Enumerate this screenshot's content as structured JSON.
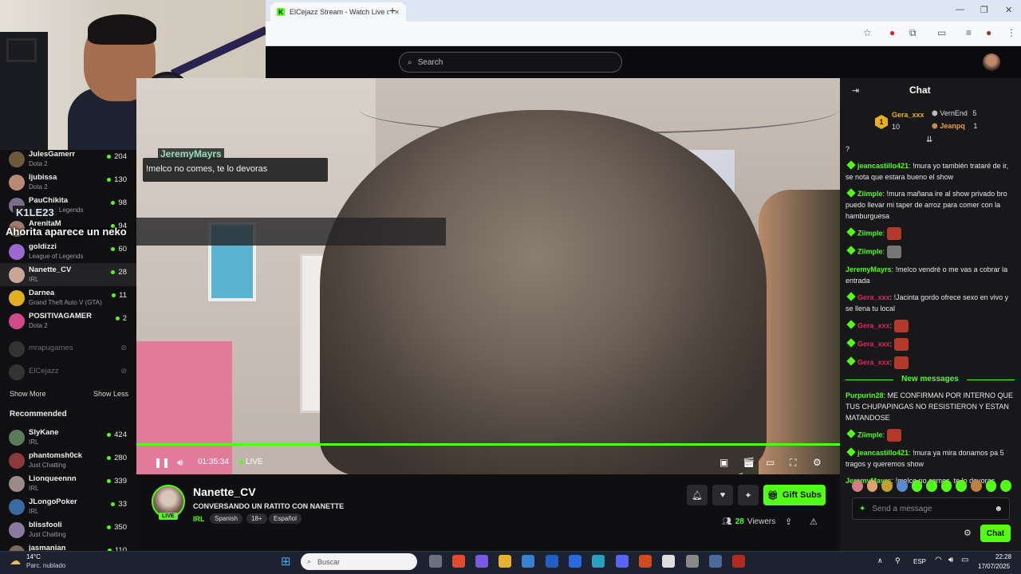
{
  "browser": {
    "tab_title": "ElCejazz Stream - Watch Live o",
    "favicon": "K",
    "new_tab": "+",
    "minimize": "—",
    "maximize": "❐",
    "close": "✕"
  },
  "webcam_overlay": {
    "tag_user": "K1LE23",
    "caption": "Ahorita aparece un neko"
  },
  "header": {
    "search_placeholder": "Search"
  },
  "sidebar": {
    "followed": [
      {
        "name": "JulesGamerr",
        "category": "Dota 2",
        "viewers": "204",
        "color": "#6d5a3c"
      },
      {
        "name": "ljubissa",
        "category": "Dota 2",
        "viewers": "130",
        "color": "#b88a73"
      },
      {
        "name": "PauChikita",
        "category": "League of Legends",
        "viewers": "98",
        "color": "#7a6c8c"
      },
      {
        "name": "ArenitaM",
        "category": "",
        "viewers": "94",
        "color": "#a07a6a"
      },
      {
        "name": "goldizzi",
        "category": "League of Legends",
        "viewers": "60",
        "color": "#9b6ad0"
      },
      {
        "name": "Nanette_CV",
        "category": "IRL",
        "viewers": "28",
        "color": "#c9a597"
      },
      {
        "name": "Darnea",
        "category": "Grand Theft Auto V (GTA)",
        "viewers": "11",
        "color": "#e0b020"
      },
      {
        "name": "POSITIVAGAMER",
        "category": "Dota 2",
        "viewers": "2",
        "color": "#d04a8a"
      }
    ],
    "offline": [
      {
        "name": "mrapugames",
        "color": "#6a6a6a"
      },
      {
        "name": "ElCejazz",
        "color": "#6a6a6a"
      }
    ],
    "show_more": "Show More",
    "show_less": "Show Less",
    "recommended_title": "Recommended",
    "recommended": [
      {
        "name": "SlyKane",
        "category": "IRL",
        "viewers": "424",
        "color": "#5a7a5a"
      },
      {
        "name": "phantomsh0ck",
        "category": "Just Chatting",
        "viewers": "280",
        "color": "#8a3a3a"
      },
      {
        "name": "Lionqueennn",
        "category": "IRL",
        "viewers": "339",
        "color": "#9a8a8a"
      },
      {
        "name": "JLongoPoker",
        "category": "IRL",
        "viewers": "33",
        "color": "#3a6aa0"
      },
      {
        "name": "blissfooli",
        "category": "Just Chatting",
        "viewers": "350",
        "color": "#8a7aa0"
      },
      {
        "name": "jasmanian",
        "category": "",
        "viewers": "110",
        "color": "#7a6a5a"
      }
    ]
  },
  "video": {
    "overlay_user": "JeremyMayrs",
    "overlay_message": "!melco no comes, te lo devoras",
    "time": "01:35:34",
    "live_label": "LIVE",
    "progress_fraction": 1.0
  },
  "stream": {
    "streamer": "Nanette_CV",
    "live_tag": "LIVE",
    "title": "CONVERSANDO UN RATITO CON NANETTE",
    "category": "IRL",
    "tags": [
      "Spanish",
      "18+",
      "Español"
    ],
    "gift_subs": "Gift Subs",
    "viewers_count": "28",
    "viewers_label": "Viewers"
  },
  "chat": {
    "title": "Chat",
    "leaderboard": {
      "first": {
        "rank": "1",
        "name": "Gera_xxx",
        "count": "10"
      },
      "second": {
        "name": "VernEnd",
        "count": "5"
      },
      "third": {
        "name": "Jeanpq",
        "count": "1"
      }
    },
    "messages": [
      {
        "user": "",
        "color": "#e8e8e8",
        "badge": false,
        "text": "?",
        "emote": ""
      },
      {
        "user": "jeancastillo421",
        "color": "#53fc18",
        "badge": true,
        "text": "!mura yo también trataré de ir, se nota que estara bueno el show",
        "emote": ""
      },
      {
        "user": "Ziimple",
        "color": "#53fc18",
        "badge": true,
        "text": "!mura mañana ire al show privado bro puedo llevar mi taper de arroz para comer con la hamburguesa",
        "emote": ""
      },
      {
        "user": "Ziimple",
        "color": "#53fc18",
        "badge": true,
        "text": "",
        "emote": "red"
      },
      {
        "user": "Ziimple",
        "color": "#53fc18",
        "badge": true,
        "text": "",
        "emote": "gray"
      },
      {
        "user": "JeremyMayrs",
        "color": "#53fc18",
        "badge": false,
        "text": "!melco vendré o me vas a cobrar la entrada",
        "emote": ""
      },
      {
        "user": "Gera_xxx",
        "color": "#e0245e",
        "badge": true,
        "text": "!Jacinta gordo ofrece sexo en vivo y se llena tu local",
        "emote": ""
      },
      {
        "user": "Gera_xxx",
        "color": "#e0245e",
        "badge": true,
        "text": "",
        "emote": "red"
      },
      {
        "user": "Gera_xxx",
        "color": "#e0245e",
        "badge": true,
        "text": "",
        "emote": "red"
      },
      {
        "user": "Gera_xxx",
        "color": "#e0245e",
        "badge": true,
        "text": "",
        "emote": "red"
      }
    ],
    "new_messages_label": "New messages",
    "new_messages": [
      {
        "user": "Purpurin28",
        "color": "#53fc18",
        "badge": false,
        "text": "ME CONFIRMAN POR INTERNO QUE TUS CHUPAPINGAS NO RESISTIERON Y ESTAN MATANDOSE",
        "emote": ""
      },
      {
        "user": "Ziimple",
        "color": "#53fc18",
        "badge": true,
        "text": "",
        "emote": "red"
      },
      {
        "user": "jeancastillo421",
        "color": "#53fc18",
        "badge": true,
        "text": "!mura ya mira donamos pa 5 tragos y queremos show",
        "emote": ""
      },
      {
        "user": "JeremyMayrs",
        "color": "#53fc18",
        "badge": false,
        "text": "!melco no comes, te lo devoras",
        "emote": ""
      }
    ],
    "input_placeholder": "Send a message",
    "send_label": "Chat"
  },
  "taskbar": {
    "temperature": "14°C",
    "weather": "Parc. nublado",
    "search_placeholder": "Buscar",
    "language": "ESP",
    "time": "22:28",
    "date": "17/07/2025"
  },
  "colors": {
    "accent": "#53fc18",
    "background": "#0f0f11",
    "chat_bg": "#18181b"
  }
}
